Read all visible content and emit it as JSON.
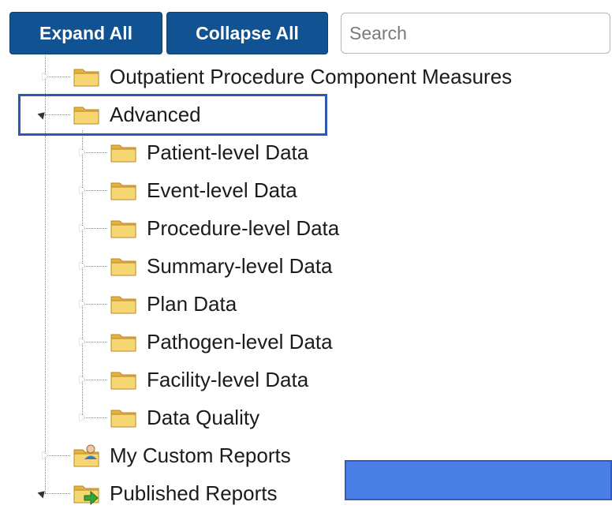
{
  "toolbar": {
    "expand_all": "Expand All",
    "collapse_all": "Collapse All",
    "search_placeholder": "Search"
  },
  "tree": {
    "outpatient": "Outpatient Procedure Component Measures",
    "advanced": "Advanced",
    "advanced_children": [
      "Patient-level Data",
      "Event-level Data",
      "Procedure-level Data",
      "Summary-level Data",
      "Plan Data",
      "Pathogen-level Data",
      "Facility-level Data",
      "Data Quality"
    ],
    "my_custom_reports": "My Custom Reports",
    "published_reports": "Published Reports"
  },
  "colors": {
    "button_bg": "#115292",
    "highlight_border": "#2f57b5",
    "blue_block": "#4a7fe6",
    "folder": "#f2c94c"
  },
  "icons": {
    "folder": "folder-icon",
    "custom_reports": "user-folder-icon",
    "published_reports": "publish-folder-icon"
  }
}
